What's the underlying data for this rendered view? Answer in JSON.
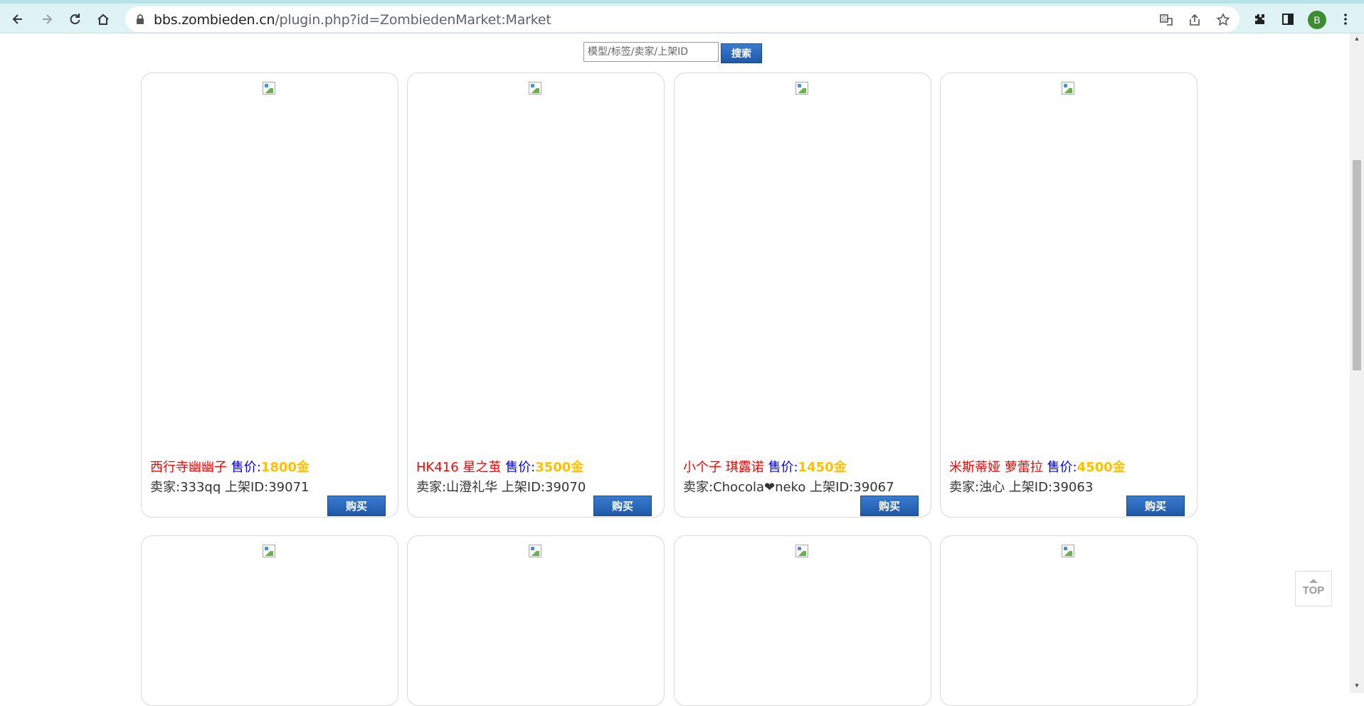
{
  "browser": {
    "url_host": "bbs.zombieden.cn",
    "url_path": "/plugin.php?id=ZombiedenMarket:Market",
    "avatar_letter": "B"
  },
  "search": {
    "placeholder": "模型/标签/卖家/上架ID",
    "button_label": "搜索"
  },
  "listings": [
    {
      "name": "西行寺幽幽子",
      "price_label": "售价:",
      "price": "1800金",
      "seller_line": "卖家:333qq 上架ID:39071",
      "buy_label": "购买"
    },
    {
      "name": "HK416 星之茧",
      "price_label": "售价:",
      "price": "3500金",
      "seller_line": "卖家:山澄礼华 上架ID:39070",
      "buy_label": "购买"
    },
    {
      "name": "小个子 琪露诺",
      "price_label": "售价:",
      "price": "1450金",
      "seller_line": "卖家:Chocola❤neko 上架ID:39067",
      "buy_label": "购买"
    },
    {
      "name": "米斯蒂娅 萝蕾拉",
      "price_label": "售价:",
      "price": "4500金",
      "seller_line": "卖家:浊心 上架ID:39063",
      "buy_label": "购买"
    }
  ],
  "top_button": {
    "label": "TOP"
  },
  "colors": {
    "name": "#ff0000",
    "price_label": "#0000ff",
    "price": "#ffc000",
    "button": "#2a68bd"
  }
}
